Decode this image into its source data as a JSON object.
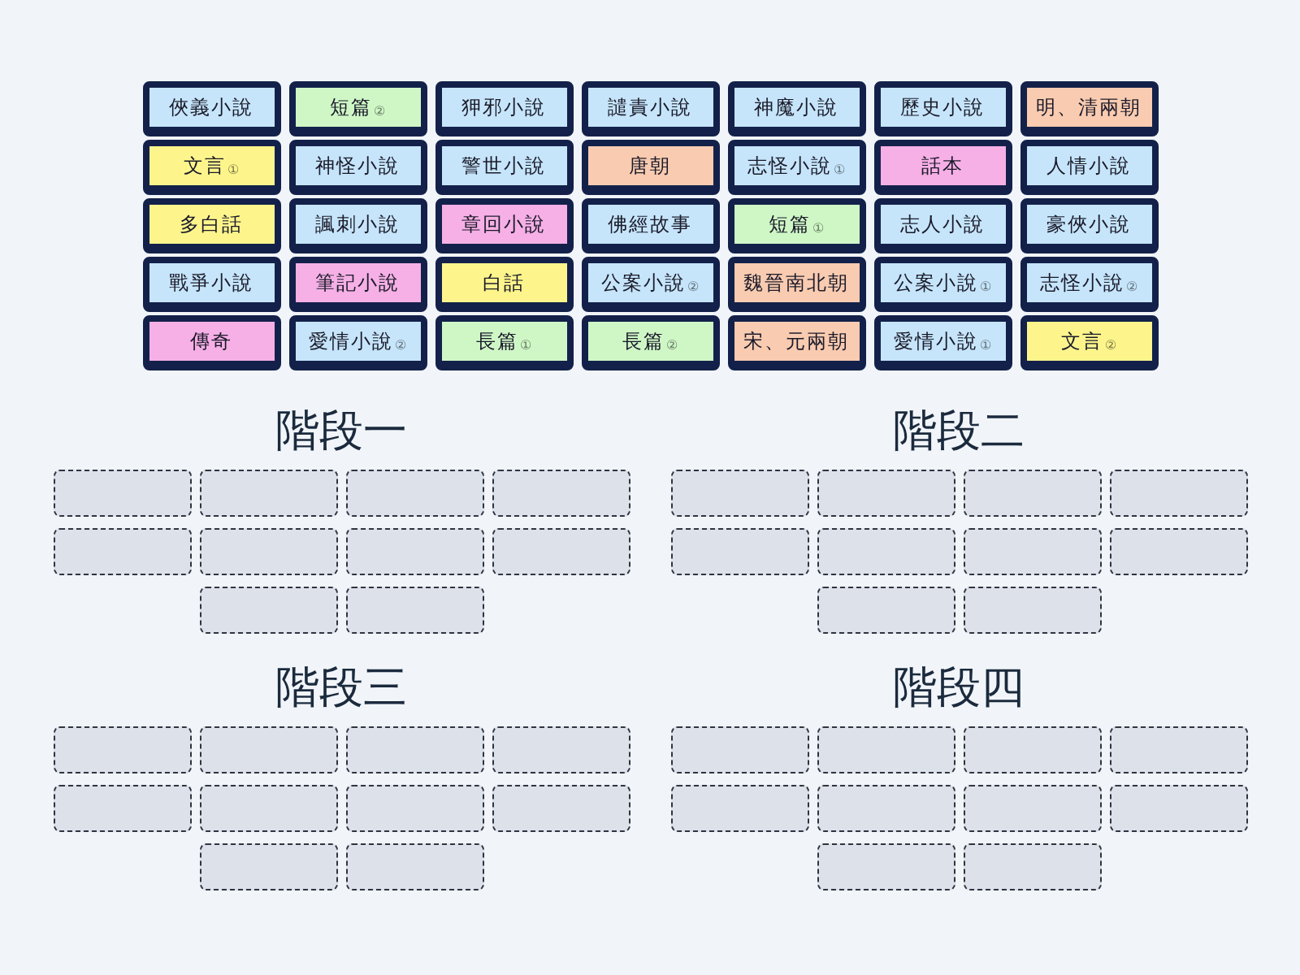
{
  "tiles": [
    {
      "label": "俠義小說",
      "color": "#c6e5fa"
    },
    {
      "label": "短篇",
      "mark": "②",
      "color": "#cff7c6"
    },
    {
      "label": "狎邪小說",
      "color": "#c6e5fa"
    },
    {
      "label": "譴責小說",
      "color": "#c6e5fa"
    },
    {
      "label": "神魔小說",
      "color": "#c6e5fa"
    },
    {
      "label": "歷史小說",
      "color": "#c6e5fa"
    },
    {
      "label": "明、清兩朝",
      "color": "#f9cbb0"
    },
    {
      "label": "文言",
      "mark": "①",
      "color": "#fdf58c"
    },
    {
      "label": "神怪小說",
      "color": "#c6e5fa"
    },
    {
      "label": "警世小說",
      "color": "#c6e5fa"
    },
    {
      "label": "唐朝",
      "color": "#f9cbb0"
    },
    {
      "label": "志怪小說",
      "mark": "①",
      "color": "#c6e5fa"
    },
    {
      "label": "話本",
      "color": "#f6b0e6"
    },
    {
      "label": "人情小說",
      "color": "#c6e5fa"
    },
    {
      "label": "多白話",
      "color": "#fdf58c"
    },
    {
      "label": "諷刺小說",
      "color": "#c6e5fa"
    },
    {
      "label": "章回小說",
      "color": "#f6b0e6"
    },
    {
      "label": "佛經故事",
      "color": "#c6e5fa"
    },
    {
      "label": "短篇",
      "mark": "①",
      "color": "#cff7c6"
    },
    {
      "label": "志人小說",
      "color": "#c6e5fa"
    },
    {
      "label": "豪俠小說",
      "color": "#c6e5fa"
    },
    {
      "label": "戰爭小說",
      "color": "#c6e5fa"
    },
    {
      "label": "筆記小說",
      "color": "#f6b0e6"
    },
    {
      "label": "白話",
      "color": "#fdf58c"
    },
    {
      "label": "公案小說",
      "mark": "②",
      "color": "#c6e5fa"
    },
    {
      "label": "魏晉南北朝",
      "color": "#f9cbb0"
    },
    {
      "label": "公案小說",
      "mark": "①",
      "color": "#c6e5fa"
    },
    {
      "label": "志怪小說",
      "mark": "②",
      "color": "#c6e5fa"
    },
    {
      "label": "傳奇",
      "color": "#f6b0e6"
    },
    {
      "label": "愛情小說",
      "mark": "②",
      "color": "#c6e5fa"
    },
    {
      "label": "長篇",
      "mark": "①",
      "color": "#cff7c6"
    },
    {
      "label": "長篇",
      "mark": "②",
      "color": "#cff7c6"
    },
    {
      "label": "宋、元兩朝",
      "color": "#f9cbb0"
    },
    {
      "label": "愛情小說",
      "mark": "①",
      "color": "#c6e5fa"
    },
    {
      "label": "文言",
      "mark": "②",
      "color": "#fdf58c"
    }
  ],
  "groups": [
    {
      "title": "階段一",
      "slots": [
        {
          "filled": false
        },
        {
          "filled": false
        },
        {
          "filled": false
        },
        {
          "filled": false
        },
        {
          "filled": false
        },
        {
          "filled": false
        },
        {
          "filled": false
        },
        {
          "filled": false
        },
        {
          "filled": false
        },
        {
          "filled": false
        }
      ]
    },
    {
      "title": "階段二",
      "slots": [
        {
          "filled": false
        },
        {
          "filled": false
        },
        {
          "filled": false
        },
        {
          "filled": false
        },
        {
          "filled": false
        },
        {
          "filled": false
        },
        {
          "filled": false
        },
        {
          "filled": false
        },
        {
          "filled": false
        },
        {
          "filled": false
        }
      ]
    },
    {
      "title": "階段三",
      "slots": [
        {
          "filled": false
        },
        {
          "filled": false
        },
        {
          "filled": false
        },
        {
          "filled": false
        },
        {
          "filled": false
        },
        {
          "filled": false
        },
        {
          "filled": false
        },
        {
          "filled": false
        },
        {
          "filled": false
        },
        {
          "filled": false
        }
      ]
    },
    {
      "title": "階段四",
      "slots": [
        {
          "filled": false
        },
        {
          "filled": false
        },
        {
          "filled": false
        },
        {
          "filled": false
        },
        {
          "filled": false
        },
        {
          "filled": false
        },
        {
          "filled": false
        },
        {
          "filled": false
        },
        {
          "filled": false
        },
        {
          "filled": false
        }
      ]
    }
  ]
}
